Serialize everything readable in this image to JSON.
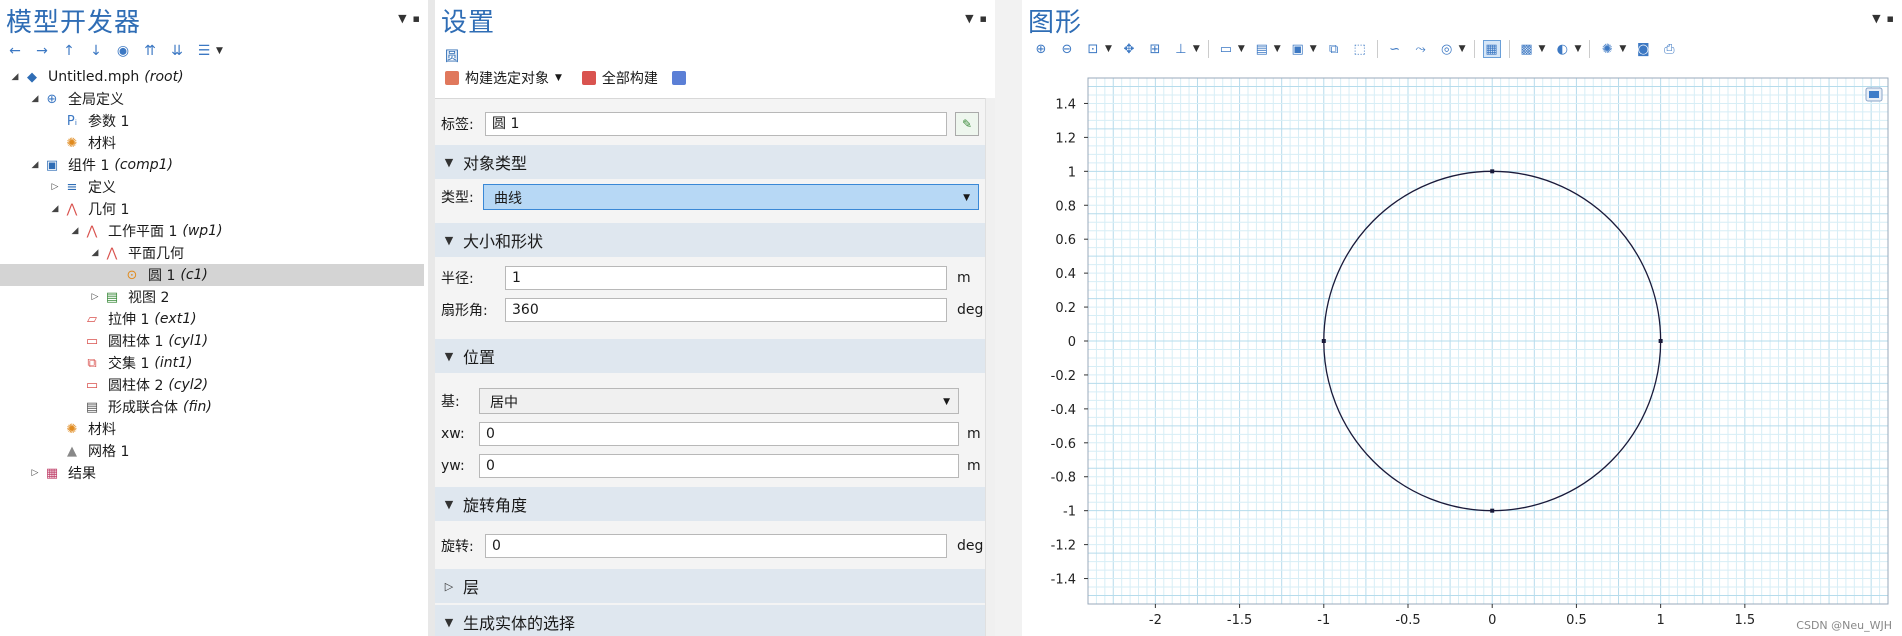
{
  "model_builder": {
    "title": "模型开发器",
    "tree": [
      {
        "label": "Untitled.mph",
        "tag": "(root)",
        "icon": "model-icon",
        "level": 0,
        "expander": "open"
      },
      {
        "label": "全局定义",
        "tag": "",
        "icon": "globe-icon",
        "level": 1,
        "expander": "open"
      },
      {
        "label": "参数 1",
        "tag": "",
        "icon": "parameters-icon",
        "level": 2,
        "expander": ""
      },
      {
        "label": "材料",
        "tag": "",
        "icon": "materials-icon",
        "level": 2,
        "expander": ""
      },
      {
        "label": "组件 1",
        "tag": "(comp1)",
        "icon": "component-icon",
        "level": 1,
        "expander": "open"
      },
      {
        "label": "定义",
        "tag": "",
        "icon": "definitions-icon",
        "level": 2,
        "expander": "closed"
      },
      {
        "label": "几何 1",
        "tag": "",
        "icon": "geometry-icon",
        "level": 2,
        "expander": "open"
      },
      {
        "label": "工作平面 1",
        "tag": "(wp1)",
        "icon": "workplane-icon",
        "level": 3,
        "expander": "open"
      },
      {
        "label": "平面几何",
        "tag": "",
        "icon": "plane-geometry-icon",
        "level": 4,
        "expander": "open"
      },
      {
        "label": "圆 1",
        "tag": "(c1)",
        "icon": "circle-icon",
        "level": 5,
        "expander": "",
        "selected": true
      },
      {
        "label": "视图 2",
        "tag": "",
        "icon": "view-icon",
        "level": 4,
        "expander": "closed"
      },
      {
        "label": "拉伸 1",
        "tag": "(ext1)",
        "icon": "extrude-icon",
        "level": 3,
        "expander": ""
      },
      {
        "label": "圆柱体 1",
        "tag": "(cyl1)",
        "icon": "cylinder-icon",
        "level": 3,
        "expander": ""
      },
      {
        "label": "交集 1",
        "tag": "(int1)",
        "icon": "intersection-icon",
        "level": 3,
        "expander": ""
      },
      {
        "label": "圆柱体 2",
        "tag": "(cyl2)",
        "icon": "cylinder-icon",
        "level": 3,
        "expander": ""
      },
      {
        "label": "形成联合体",
        "tag": "(fin)",
        "icon": "form-union-icon",
        "level": 3,
        "expander": ""
      },
      {
        "label": "材料",
        "tag": "",
        "icon": "materials-icon",
        "level": 2,
        "expander": ""
      },
      {
        "label": "网格 1",
        "tag": "",
        "icon": "mesh-icon",
        "level": 2,
        "expander": ""
      },
      {
        "label": "结果",
        "tag": "",
        "icon": "results-icon",
        "level": 1,
        "expander": "closed"
      }
    ]
  },
  "settings": {
    "title": "设置",
    "subtitle": "圆",
    "build_selected": "构建选定对象",
    "build_all": "全部构建",
    "label_caption": "标签:",
    "label_value": "圆 1",
    "sections": {
      "object_type": "对象类型",
      "size_shape": "大小和形状",
      "position": "位置",
      "rotation": "旋转角度",
      "layers": "层",
      "selections": "生成实体的选择"
    },
    "type_caption": "类型:",
    "type_value": "曲线",
    "radius_caption": "半径:",
    "radius_value": "1",
    "radius_unit": "m",
    "sector_caption": "扇形角:",
    "sector_value": "360",
    "sector_unit": "deg",
    "base_caption": "基:",
    "base_value": "居中",
    "xw_caption": "xw:",
    "xw_value": "0",
    "xw_unit": "m",
    "yw_caption": "yw:",
    "yw_value": "0",
    "yw_unit": "m",
    "rotation_caption": "旋转:",
    "rotation_value": "0",
    "rotation_unit": "deg"
  },
  "graphics": {
    "title": "图形",
    "x_ticks": [
      "-2",
      "-1.5",
      "-1",
      "-0.5",
      "0",
      "0.5",
      "1",
      "1.5"
    ],
    "y_ticks": [
      "1.4",
      "1.2",
      "1",
      "0.8",
      "0.6",
      "0.4",
      "0.2",
      "0",
      "-0.2",
      "-0.4",
      "-0.6",
      "-0.8",
      "-1",
      "-1.2",
      "-1.4"
    ],
    "watermark": "CSDN @Neu_WJH",
    "colors": {
      "grid_minor": "#d7eef6",
      "grid_major": "#b6dcec",
      "circle": "#1a1a3a",
      "accent": "#2f6db5"
    }
  },
  "chart_data": {
    "type": "scatter",
    "title": "",
    "xlabel": "",
    "ylabel": "",
    "xlim": [
      -2.4,
      2.35
    ],
    "ylim": [
      -1.55,
      1.55
    ],
    "grid": true,
    "shape": {
      "kind": "circle",
      "center": [
        0,
        0
      ],
      "radius": 1
    },
    "vertices": [
      [
        0,
        1
      ],
      [
        1,
        0
      ],
      [
        0,
        -1
      ],
      [
        -1,
        0
      ]
    ]
  }
}
